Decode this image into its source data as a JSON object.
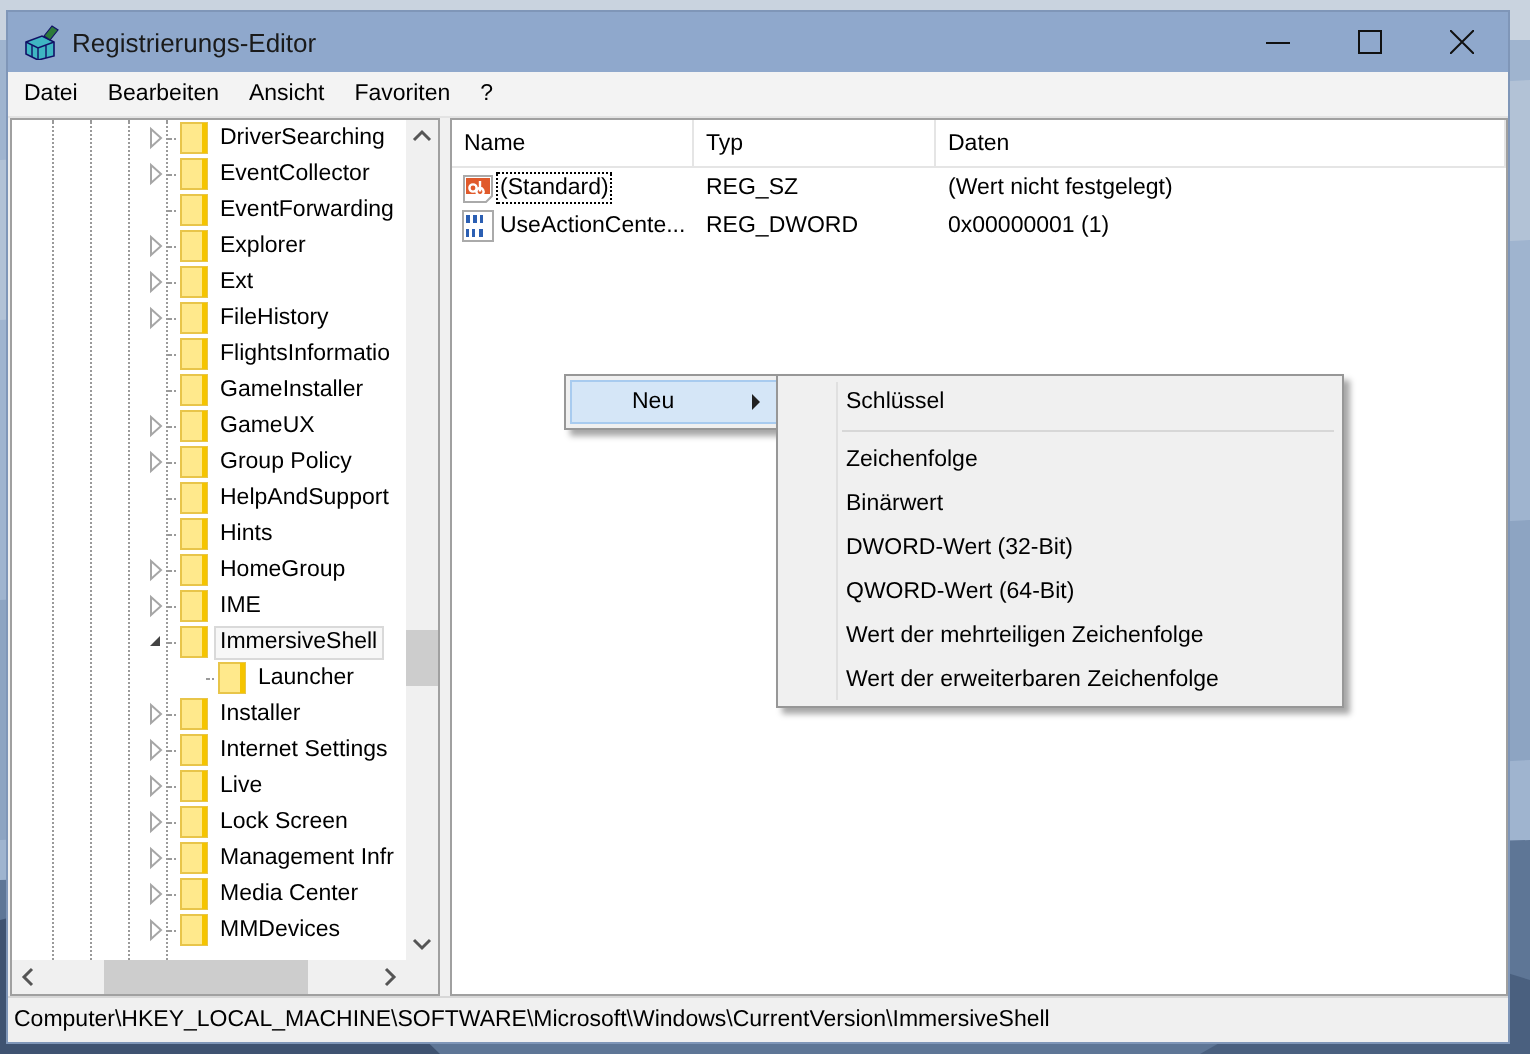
{
  "window": {
    "title": "Registrierungs-Editor"
  },
  "menu_bar": [
    "Datei",
    "Bearbeiten",
    "Ansicht",
    "Favoriten",
    "?"
  ],
  "tree": {
    "items": [
      {
        "label": "DriverSearching",
        "expandable": true,
        "expanded": false,
        "selected": false
      },
      {
        "label": "EventCollector",
        "expandable": true,
        "expanded": false,
        "selected": false
      },
      {
        "label": "EventForwarding",
        "expandable": false,
        "selected": false
      },
      {
        "label": "Explorer",
        "expandable": true,
        "expanded": false,
        "selected": false
      },
      {
        "label": "Ext",
        "expandable": true,
        "expanded": false,
        "selected": false
      },
      {
        "label": "FileHistory",
        "expandable": true,
        "expanded": false,
        "selected": false
      },
      {
        "label": "FlightsInformatio",
        "expandable": false,
        "selected": false
      },
      {
        "label": "GameInstaller",
        "expandable": false,
        "selected": false
      },
      {
        "label": "GameUX",
        "expandable": true,
        "expanded": false,
        "selected": false
      },
      {
        "label": "Group Policy",
        "expandable": true,
        "expanded": false,
        "selected": false
      },
      {
        "label": "HelpAndSupport",
        "expandable": false,
        "selected": false
      },
      {
        "label": "Hints",
        "expandable": false,
        "selected": false
      },
      {
        "label": "HomeGroup",
        "expandable": true,
        "expanded": false,
        "selected": false
      },
      {
        "label": "IME",
        "expandable": true,
        "expanded": false,
        "selected": false
      },
      {
        "label": "ImmersiveShell",
        "expandable": true,
        "expanded": true,
        "selected": true,
        "children": [
          {
            "label": "Launcher",
            "expandable": false,
            "selected": false
          }
        ]
      },
      {
        "label": "Installer",
        "expandable": true,
        "expanded": false,
        "selected": false
      },
      {
        "label": "Internet Settings",
        "expandable": true,
        "expanded": false,
        "selected": false
      },
      {
        "label": "Live",
        "expandable": true,
        "expanded": false,
        "selected": false
      },
      {
        "label": "Lock Screen",
        "expandable": true,
        "expanded": false,
        "selected": false
      },
      {
        "label": "Management Infr",
        "expandable": true,
        "expanded": false,
        "selected": false
      },
      {
        "label": "Media Center",
        "expandable": true,
        "expanded": false,
        "selected": false
      },
      {
        "label": "MMDevices",
        "expandable": true,
        "expanded": false,
        "selected": false
      }
    ]
  },
  "values": {
    "columns": [
      "Name",
      "Typ",
      "Daten"
    ],
    "rows": [
      {
        "kind": "string",
        "name": "(Standard)",
        "type": "REG_SZ",
        "data": "(Wert nicht festgelegt)",
        "focused": true
      },
      {
        "kind": "dword",
        "name": "UseActionCente...",
        "type": "REG_DWORD",
        "data": "0x00000001 (1)",
        "focused": false
      }
    ]
  },
  "context_menu": {
    "items": [
      {
        "label": "Neu",
        "selected": true,
        "submenu": true
      }
    ]
  },
  "submenu": {
    "items": [
      {
        "kind": "item",
        "label": "Schlüssel"
      },
      {
        "kind": "separator"
      },
      {
        "kind": "item",
        "label": "Zeichenfolge"
      },
      {
        "kind": "item",
        "label": "Binärwert"
      },
      {
        "kind": "item",
        "label": "DWORD-Wert (32-Bit)"
      },
      {
        "kind": "item",
        "label": "QWORD-Wert (64-Bit)"
      },
      {
        "kind": "item",
        "label": "Wert der mehrteiligen Zeichenfolge"
      },
      {
        "kind": "item",
        "label": "Wert der erweiterbaren Zeichenfolge"
      }
    ]
  },
  "status_bar": "Computer\\HKEY_LOCAL_MACHINE\\SOFTWARE\\Microsoft\\Windows\\CurrentVersion\\ImmersiveShell"
}
